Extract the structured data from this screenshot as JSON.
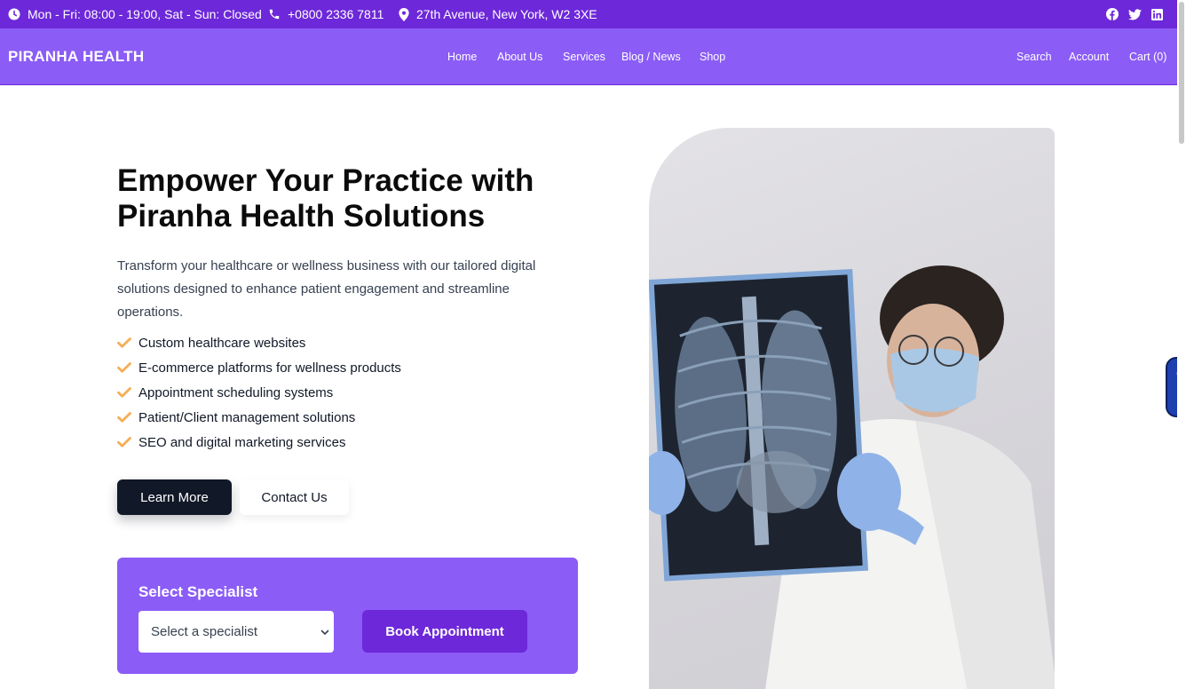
{
  "topbar": {
    "hours": "Mon - Fri: 08:00 - 19:00, Sat - Sun: Closed",
    "phone": "+0800 2336 7811",
    "address": "27th Avenue, New York, W2 3XE",
    "social_icons": [
      "facebook-icon",
      "twitter-icon",
      "linkedin-icon"
    ]
  },
  "nav": {
    "brand": "PIRANHA HEALTH",
    "links": [
      "Home",
      "About Us",
      "Services",
      "Blog / News",
      "Shop"
    ],
    "right_links": [
      "Search",
      "Account",
      "Cart (0)"
    ]
  },
  "hero": {
    "title_line1": "Empower Your Practice with",
    "title_line2": "Piranha Health Solutions",
    "description": "Transform your healthcare or wellness business with our tailored digital solutions designed to enhance patient engagement and streamline operations.",
    "features": [
      "Custom healthcare websites",
      "E-commerce platforms for wellness products",
      "Appointment scheduling systems",
      "Patient/Client management solutions",
      "SEO and digital marketing services"
    ],
    "learn_more": "Learn More",
    "contact_us": "Contact Us"
  },
  "booking": {
    "title": "Select Specialist",
    "select_value": "Select a specialist",
    "book_button": "Book Appointment"
  },
  "colors": {
    "topbar": "#6d28d9",
    "nav": "#8b5cf6",
    "accent_check": "#f6ad55",
    "dark_button": "#111827",
    "book_button": "#6d28d9"
  }
}
